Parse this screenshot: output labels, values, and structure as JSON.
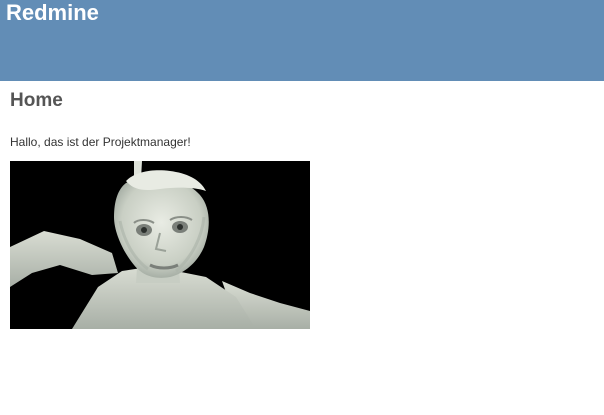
{
  "header": {
    "title": "Redmine"
  },
  "page": {
    "title": "Home",
    "text": "Hallo, das ist der Projektmanager!"
  },
  "image": {
    "subject": "pale figure with face looking forward"
  },
  "colors": {
    "header_bg": "#628db6",
    "page_title": "#555555",
    "text": "#333333",
    "image_bg": "#000000"
  }
}
